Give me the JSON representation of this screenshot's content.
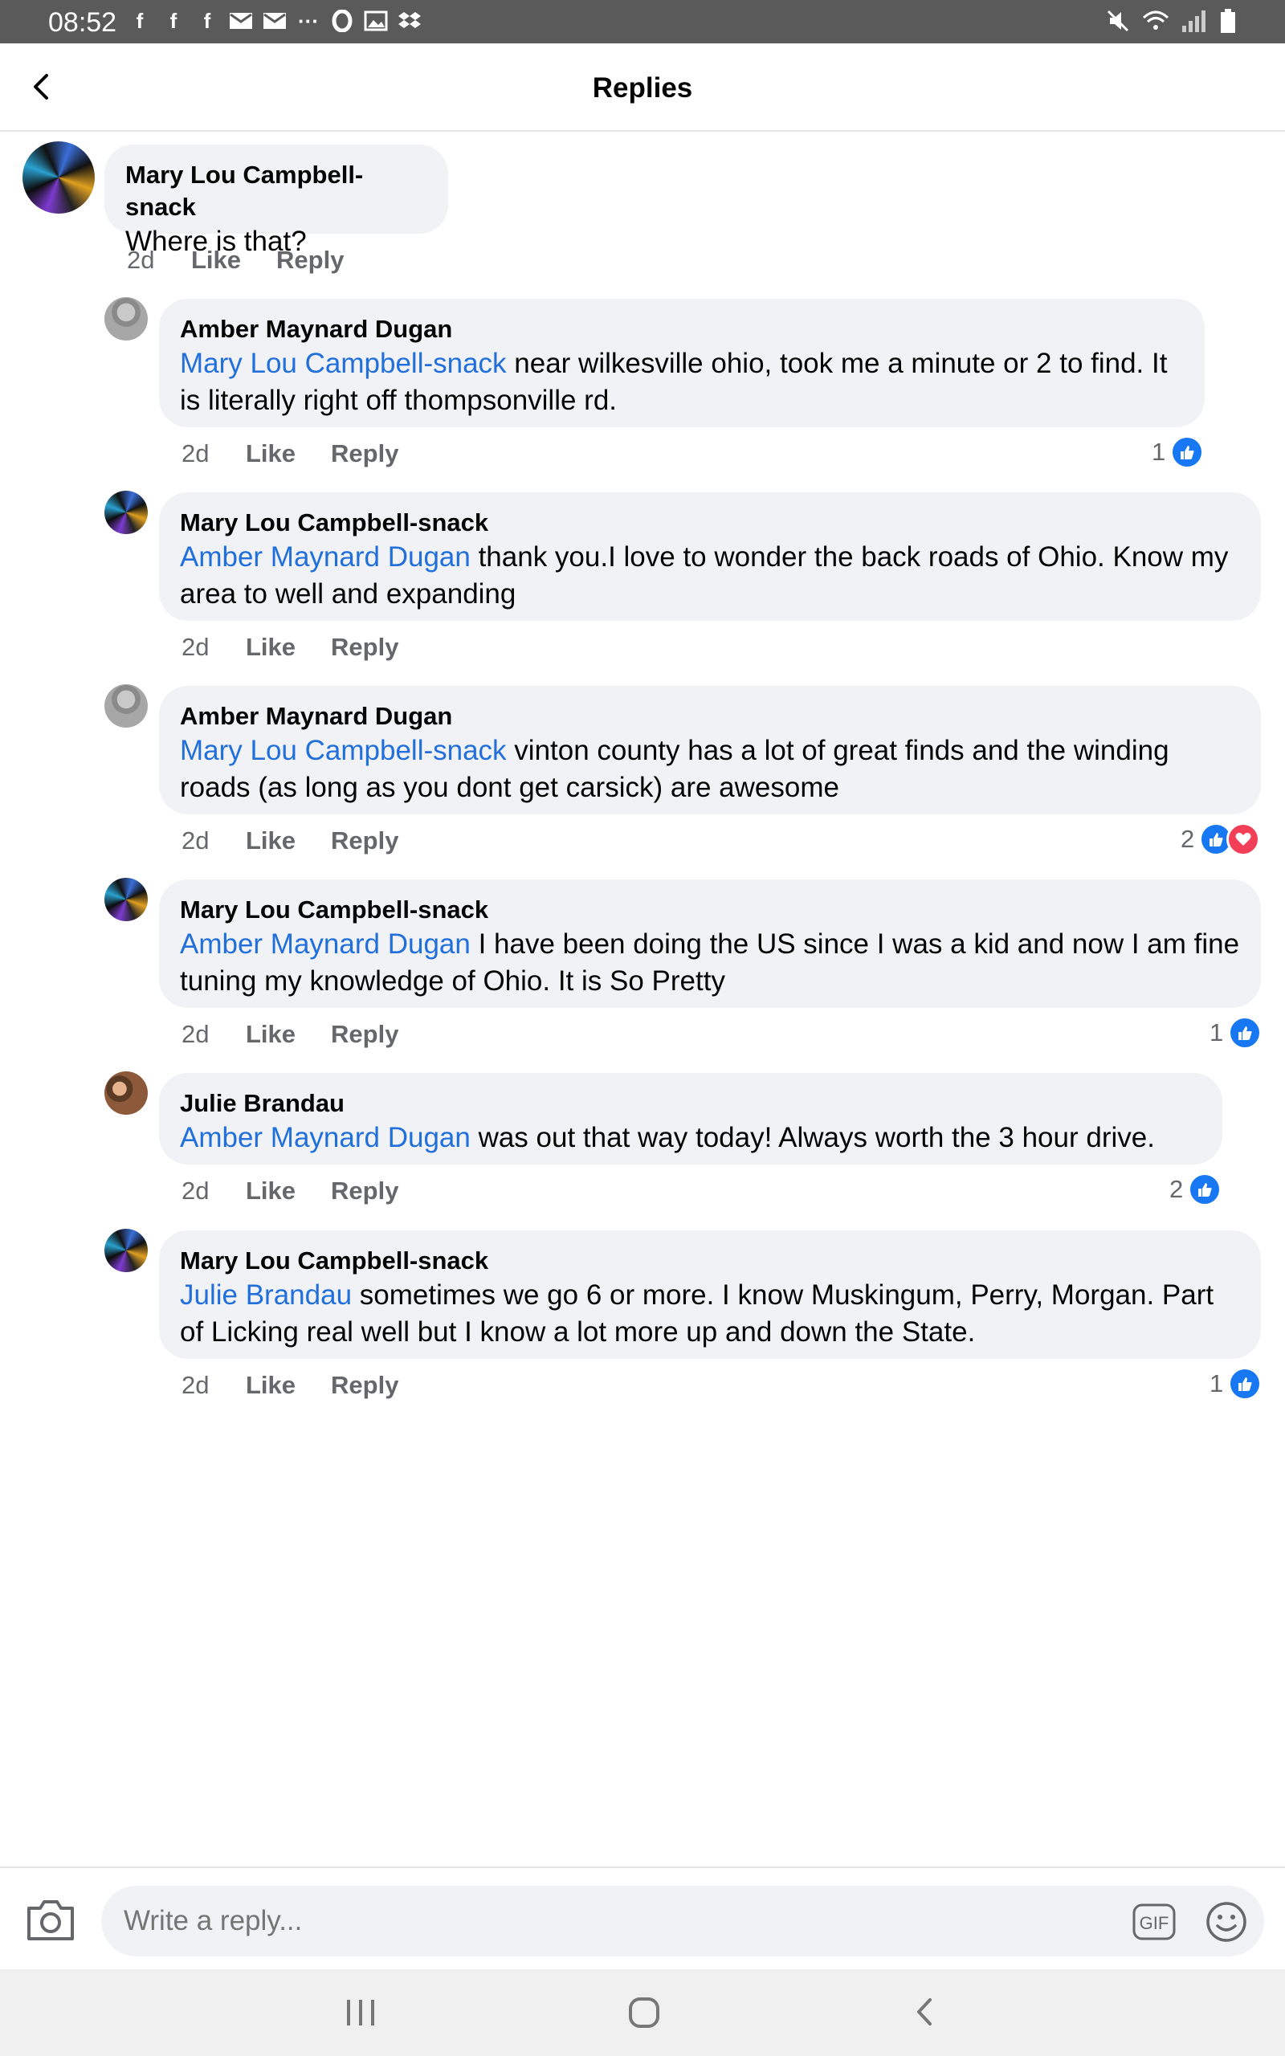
{
  "status_bar": {
    "time": "08:52",
    "notification_icons": [
      "facebook-icon",
      "facebook-icon",
      "facebook-icon",
      "mail-icon",
      "mail-icon",
      "more-dots-icon",
      "opera-icon",
      "gallery-icon",
      "dropbox-icon"
    ],
    "system_icons": [
      "mute-icon",
      "wifi-icon",
      "signal-icon",
      "battery-icon"
    ]
  },
  "header": {
    "title": "Replies"
  },
  "parent_comment": {
    "author": "Mary Lou Campbell-snack",
    "text": "Where is that?",
    "time": "2d",
    "like_label": "Like",
    "reply_label": "Reply"
  },
  "replies": [
    {
      "author": "Amber Maynard Dugan",
      "mention": "Mary Lou Campbell-snack",
      "text": " near wilkesville ohio, took me a minute or 2 to find. It is literally right off thompsonville rd.",
      "time": "2d",
      "like_label": "Like",
      "reply_label": "Reply",
      "reaction_count": "1",
      "reactions": [
        "like"
      ]
    },
    {
      "author": "Mary Lou Campbell-snack",
      "mention": "Amber Maynard Dugan",
      "text": " thank you.I love to wonder the back roads of Ohio. Know my area to well and expanding",
      "time": "2d",
      "like_label": "Like",
      "reply_label": "Reply",
      "reaction_count": "",
      "reactions": []
    },
    {
      "author": "Amber Maynard Dugan",
      "mention": "Mary Lou Campbell-snack",
      "text": " vinton county has a lot of great finds and the winding roads (as long as you dont get carsick) are awesome",
      "time": "2d",
      "like_label": "Like",
      "reply_label": "Reply",
      "reaction_count": "2",
      "reactions": [
        "like",
        "love"
      ]
    },
    {
      "author": "Mary Lou Campbell-snack",
      "mention": "Amber Maynard Dugan",
      "text": " I have been doing the US since I was a kid and now I am fine tuning my knowledge of Ohio. It is So Pretty",
      "time": "2d",
      "like_label": "Like",
      "reply_label": "Reply",
      "reaction_count": "1",
      "reactions": [
        "like"
      ]
    },
    {
      "author": "Julie Brandau",
      "mention": "Amber Maynard Dugan",
      "text": " was out that way today! Always worth the 3 hour drive.",
      "time": "2d",
      "like_label": "Like",
      "reply_label": "Reply",
      "reaction_count": "2",
      "reactions": [
        "like"
      ]
    },
    {
      "author": "Mary Lou Campbell-snack",
      "mention": "Julie Brandau",
      "text": " sometimes we go 6 or more. I know Muskingum, Perry, Morgan. Part of Licking real well but I know a lot more up and down the State.",
      "time": "2d",
      "like_label": "Like",
      "reply_label": "Reply",
      "reaction_count": "1",
      "reactions": [
        "like"
      ]
    }
  ],
  "composer": {
    "placeholder": "Write a reply...",
    "gif_label": "GIF"
  },
  "colors": {
    "mention": "#216fdb",
    "bubble": "#f0f2f5",
    "like": "#1877f2",
    "love": "#f33e58",
    "meta_text": "#65676b"
  }
}
